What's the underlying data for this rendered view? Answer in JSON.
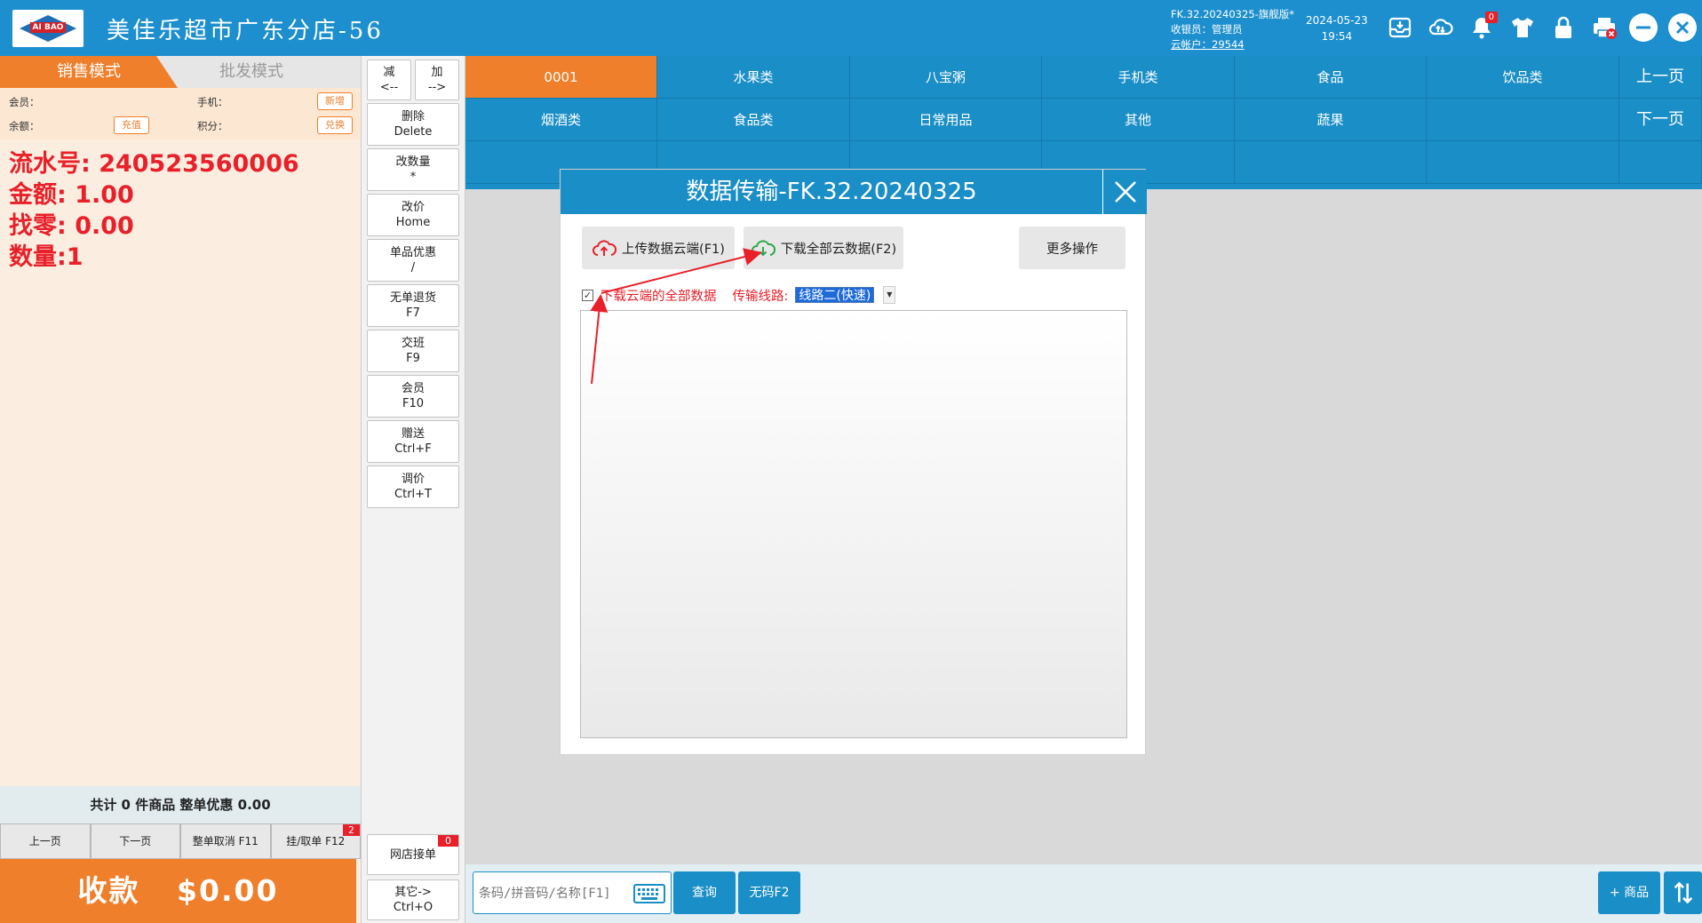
{
  "header": {
    "logo_text": "AI BAO",
    "title": "美佳乐超市广东分店-56",
    "version": "FK.32.20240325-旗舰版*",
    "cashier": "收银员：管理员",
    "cloud_account": "云帐户：29544",
    "date": "2024-05-23",
    "time": "19:54",
    "notification_count": "0"
  },
  "left_panel": {
    "tab_sales": "销售模式",
    "tab_wholesale": "批发模式",
    "member_label": "会员：",
    "phone_label": "手机：",
    "balance_label": "余额：",
    "points_label": "积分：",
    "btn_new": "新增",
    "btn_recharge": "充值",
    "btn_redeem": "兑换",
    "serial_line": "流水号: 240523560006",
    "amount_line": "金额: 1.00",
    "change_line": "找零: 0.00",
    "qty_line": "数量:1",
    "totals": "共计 0 件商品 整单优惠 0.00",
    "page_prev": "上一页",
    "page_next": "下一页",
    "cancel_order": "整单取消 F11",
    "hold_order": "挂/取单 F12",
    "hold_badge": "2",
    "pay_label": "收款",
    "pay_amount": "$0.00"
  },
  "actions": {
    "minus_l1": "减",
    "minus_l2": "<--",
    "plus_l1": "加",
    "plus_l2": "-->",
    "delete_l1": "删除",
    "delete_l2": "Delete",
    "qty_l1": "改数量",
    "qty_l2": "*",
    "price_l1": "改价",
    "price_l2": "Home",
    "item_disc_l1": "单品优惠",
    "item_disc_l2": "/",
    "return_l1": "无单退货",
    "return_l2": "F7",
    "shift_l1": "交班",
    "shift_l2": "F9",
    "member_l1": "会员",
    "member_l2": "F10",
    "gift_l1": "赠送",
    "gift_l2": "Ctrl+F",
    "adjust_l1": "调价",
    "adjust_l2": "Ctrl+T",
    "online_orders": "网店接单",
    "online_badge": "0",
    "other_l1": "其它->",
    "other_l2": "Ctrl+O"
  },
  "categories": {
    "row1": [
      "0001",
      "水果类",
      "八宝粥",
      "手机类",
      "食品",
      "饮品类"
    ],
    "row2": [
      "烟酒类",
      "食品类",
      "日常用品",
      "其他",
      "蔬果"
    ],
    "prev_page": "上一页",
    "next_page": "下一页"
  },
  "bottom": {
    "search_placeholder": "条码/拼音码/名称[F1]",
    "query": "查询",
    "no_code": "无码F2",
    "add_product": "+ 商品"
  },
  "dialog": {
    "title": "数据传输-FK.32.20240325",
    "upload_btn": "上传数据云端(F1)",
    "download_btn": "下载全部云数据(F2)",
    "more_btn": "更多操作",
    "checkbox_label": "下载云端的全部数据",
    "route_label": "传输线路:",
    "route_value": "线路二(快速)"
  },
  "colors": {
    "primary_blue": "#1a8ec6",
    "accent_orange": "#f07f2b",
    "alert_red": "#e8202a"
  }
}
